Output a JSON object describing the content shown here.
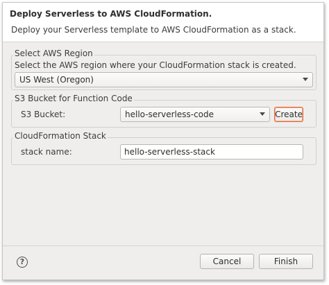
{
  "banner": {
    "title": "Deploy Serverless to AWS CloudFormation.",
    "description": "Deploy your Serverless template to AWS CloudFormation as a stack."
  },
  "region_group": {
    "title": "Select AWS Region",
    "hint": "Select the AWS region where your CloudFormation stack is created.",
    "selected": "US West (Oregon)"
  },
  "bucket_group": {
    "title": "S3 Bucket for Function Code",
    "label": "S3 Bucket:",
    "selected": "hello-serverless-code",
    "create_label": "Create"
  },
  "stack_group": {
    "title": "CloudFormation Stack",
    "label": "stack name:",
    "value": "hello-serverless-stack"
  },
  "footer": {
    "help_glyph": "?",
    "cancel_label": "Cancel",
    "finish_label": "Finish"
  },
  "colors": {
    "dialog_bg": "#efeeec",
    "focus_border": "#e0693b"
  }
}
